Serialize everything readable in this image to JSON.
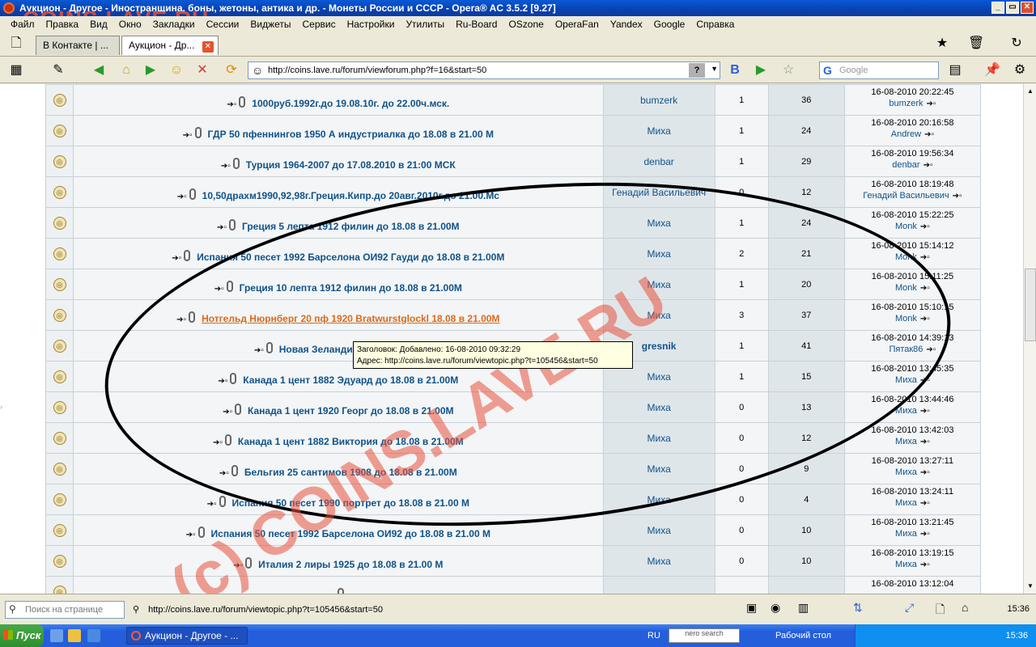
{
  "window": {
    "title": "Аукцион - Другое - Иностранщина, боны, жетоны, антика и др. - Монеты России и СССР - Opera® AC 3.5.2 [9.27]",
    "watermark_top": "COINS.LAVE.RU",
    "controls": [
      "_",
      "▭",
      "✕"
    ]
  },
  "menu": [
    "Файл",
    "Правка",
    "Вид",
    "Окно",
    "Закладки",
    "Сессии",
    "Виджеты",
    "Сервис",
    "Настройки",
    "Утилиты",
    "Ru-Board",
    "OSzone",
    "OperaFan",
    "Yandex",
    "Google",
    "Справка"
  ],
  "tabs": [
    {
      "label": "В Контакте | ...",
      "active": false
    },
    {
      "label": "Аукцион - Др...",
      "active": true,
      "close": "✕"
    }
  ],
  "address": {
    "url": "http://coins.lave.ru/forum/viewforum.php?f=16&start=50",
    "help": "?"
  },
  "search": {
    "placeholder": "Google"
  },
  "topics": [
    {
      "title": "1000руб.1992г.до 19.08.10г. до 22.00ч.мск.",
      "author": "bumzerk",
      "replies": "1",
      "views": "36",
      "last_date": "16-08-2010 20:22:45",
      "last_user": "bumzerk"
    },
    {
      "title": "ГДР 50 пфеннингов 1950 А индустриалка до 18.08 в 21.00 М",
      "author": "Миха",
      "replies": "1",
      "views": "24",
      "last_date": "16-08-2010 20:16:58",
      "last_user": "Andrew"
    },
    {
      "title": "Турция 1964-2007 до 17.08.2010 в 21:00 МСК",
      "author": "denbar",
      "replies": "1",
      "views": "29",
      "last_date": "16-08-2010 19:56:34",
      "last_user": "denbar"
    },
    {
      "title": "10,50драхм1990,92,98г.Греция.Кипр.до 20авг.2010г.до 21.00.Мс",
      "author": "Генадий Васильевич",
      "replies": "0",
      "views": "12",
      "last_date": "16-08-2010 18:19:48",
      "last_user": "Генадий Васильевич"
    },
    {
      "title": "Греция 5 лепта 1912 филин до 18.08 в 21.00М",
      "author": "Миха",
      "replies": "1",
      "views": "24",
      "last_date": "16-08-2010 15:22:25",
      "last_user": "Monk"
    },
    {
      "title": "Испания 50 песет 1992 Барселона ОИ92 Гауди до 18.08 в 21.00М",
      "author": "Миха",
      "replies": "2",
      "views": "21",
      "last_date": "16-08-2010 15:14:12",
      "last_user": "Monk"
    },
    {
      "title": "Греция 10 лепта 1912 филин до 18.08 в 21.00М",
      "author": "Миха",
      "replies": "1",
      "views": "20",
      "last_date": "16-08-2010 15:11:25",
      "last_user": "Monk"
    },
    {
      "title": "Нотгельд Нюрнберг 20 пф 1920 Bratwurstglockl 18.08 в 21.00М",
      "author": "Миха",
      "replies": "3",
      "views": "37",
      "last_date": "16-08-2010 15:10:15",
      "last_user": "Monk",
      "visited": true
    },
    {
      "title": "Новая Зеландия, буклет, 1990",
      "author": "gresnik",
      "replies": "1",
      "views": "41",
      "last_date": "16-08-2010 14:39:13",
      "last_user": "Пятак86",
      "author_bold": true
    },
    {
      "title": "Канада 1 цент 1882 Эдуард до 18.08 в 21.00М",
      "author": "Миха",
      "replies": "1",
      "views": "15",
      "last_date": "16-08-2010 13:45:35",
      "last_user": "Миха"
    },
    {
      "title": "Канада 1 цент 1920 Георг до 18.08 в 21.00М",
      "author": "Миха",
      "replies": "0",
      "views": "13",
      "last_date": "16-08-2010 13:44:46",
      "last_user": "Миха"
    },
    {
      "title": "Канада 1 цент 1882 Виктория до 18.08 в 21.00М",
      "author": "Миха",
      "replies": "0",
      "views": "12",
      "last_date": "16-08-2010 13:42:03",
      "last_user": "Миха"
    },
    {
      "title": "Бельгия 25 сантимов 1908 до 18.08 в 21.00М",
      "author": "Миха",
      "replies": "0",
      "views": "9",
      "last_date": "16-08-2010 13:27:11",
      "last_user": "Миха"
    },
    {
      "title": "Испания 50 песет 1990 портрет до 18.08 в 21.00 М",
      "author": "Миха",
      "replies": "0",
      "views": "4",
      "last_date": "16-08-2010 13:24:11",
      "last_user": "Миха"
    },
    {
      "title": "Испания 50 песет 1992 Барселона ОИ92 до 18.08 в 21.00 М",
      "author": "Миха",
      "replies": "0",
      "views": "10",
      "last_date": "16-08-2010 13:21:45",
      "last_user": "Миха"
    },
    {
      "title": "Италия 2 лиры 1925 до 18.08 в 21.00 М",
      "author": "Миха",
      "replies": "0",
      "views": "10",
      "last_date": "16-08-2010 13:19:15",
      "last_user": "Миха"
    },
    {
      "title": "",
      "author": "",
      "replies": "",
      "views": "",
      "last_date": "16-08-2010 13:12:04",
      "last_user": ""
    }
  ],
  "tooltip": {
    "line1": "Заголовок: Добавлено: 16-08-2010 09:32:29",
    "line2": "Адрес: http://coins.lave.ru/forum/viewtopic.php?t=105456&start=50"
  },
  "watermark_big": "(c) COINS.LAVE.RU",
  "statusbar": {
    "find_placeholder": "Поиск на странице",
    "url": "http://coins.lave.ru/forum/viewtopic.php?t=105456&start=50",
    "clock": "15:36"
  },
  "taskbar": {
    "start": "Пуск",
    "task": "Аукцион - Другое - ...",
    "lang": "RU",
    "nero": "nero search",
    "desktop": "Рабочий стол",
    "clock": "15:36"
  }
}
